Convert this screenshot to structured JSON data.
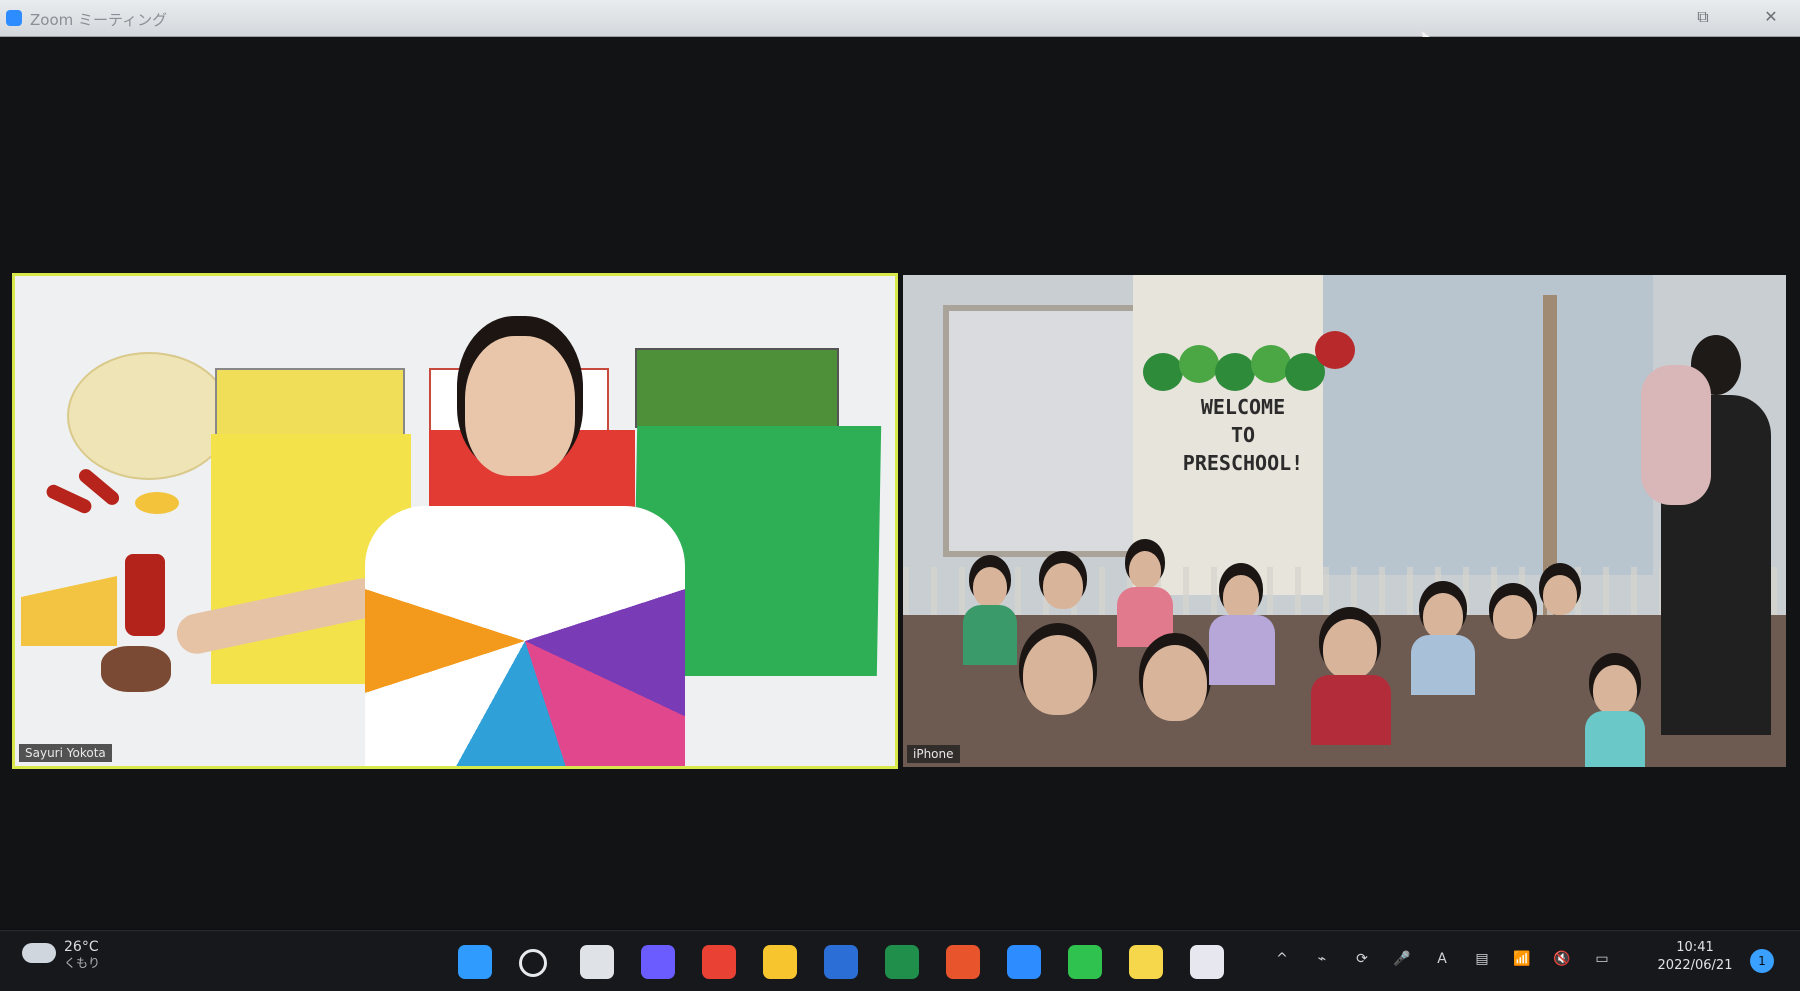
{
  "window": {
    "title": "Zoom ミーティング",
    "restore_glyph": "⧉",
    "close_glyph": "✕"
  },
  "meeting": {
    "left_tile": {
      "name": "Sayuri Yokota"
    },
    "right_tile": {
      "name": "iPhone",
      "banner_lines": [
        "WELCOME",
        "TO",
        "PRESCHOOL!"
      ]
    }
  },
  "taskbar": {
    "weather": {
      "temp": "26°C",
      "condition": "くもり"
    },
    "apps": [
      {
        "name": "start-icon",
        "color": "#2f9bff"
      },
      {
        "name": "search-icon",
        "color": "#e6e9ee"
      },
      {
        "name": "task-view-icon",
        "color": "#dfe3e8"
      },
      {
        "name": "chat-icon",
        "color": "#6a5cff"
      },
      {
        "name": "chrome-icon",
        "color": "#e94235"
      },
      {
        "name": "file-explorer-icon",
        "color": "#f7c52d"
      },
      {
        "name": "word-icon",
        "color": "#2b6fd6"
      },
      {
        "name": "excel-icon",
        "color": "#1f8f4b"
      },
      {
        "name": "powerpoint-icon",
        "color": "#e8552d"
      },
      {
        "name": "zoom-icon",
        "color": "#2d8cff"
      },
      {
        "name": "line-icon",
        "color": "#2fc24f"
      },
      {
        "name": "sticky-notes-icon",
        "color": "#f6d64a"
      },
      {
        "name": "itunes-icon",
        "color": "#e7e7ef"
      }
    ],
    "tray_glyphs": [
      "^",
      "⌁",
      "⟳",
      "🎤",
      "A",
      "▤",
      "📶",
      "🔇",
      "▭"
    ],
    "clock": {
      "time": "10:41",
      "date": "2022/06/21"
    },
    "notification_glyph": "1"
  }
}
